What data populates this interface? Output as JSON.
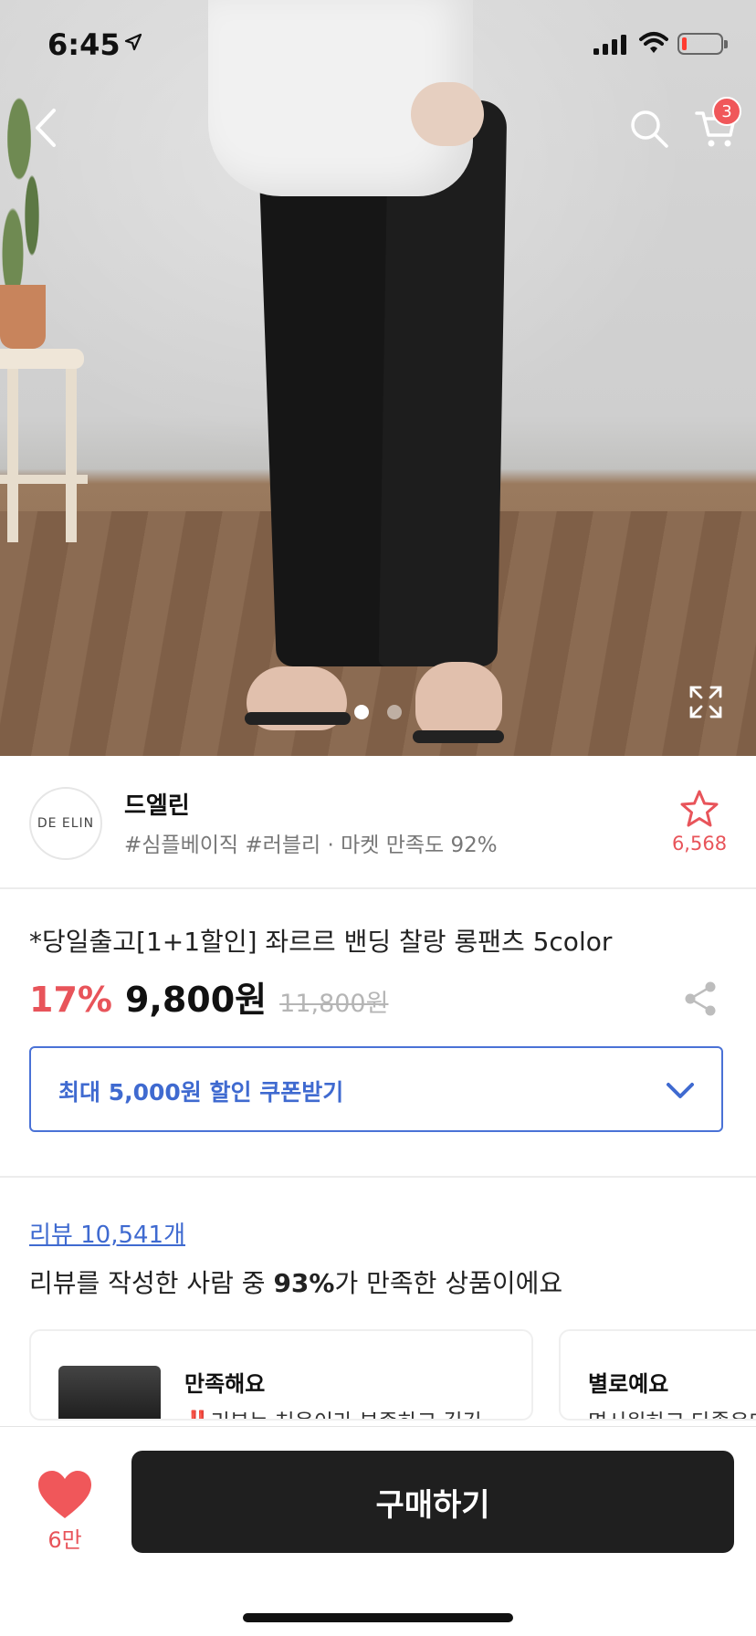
{
  "status_bar": {
    "time": "6:45"
  },
  "hero": {
    "slide_count": 2,
    "active_slide": 1
  },
  "header": {
    "cart_count": "3"
  },
  "store": {
    "logo_text": "DE ELIN",
    "name": "드엘린",
    "tags": "#심플베이직 #러블리 · 마켓 만족도 92%",
    "favorite_count": "6,568"
  },
  "product": {
    "title": "*당일출고[1+1할인] 좌르르 밴딩 찰랑 롱팬츠 5color",
    "discount": "17%",
    "price": "9,800원",
    "original_price": "11,800원"
  },
  "coupon": {
    "label": "최대 5,000원 할인 쿠폰받기"
  },
  "reviews": {
    "link_label": "리뷰 10,541개",
    "summary_prefix": "리뷰를 작성한 사람 중 ",
    "summary_percent": "93%",
    "summary_suffix": "가 만족한 상품이에요",
    "cards": [
      {
        "title": "만족해요",
        "excl": "‼️",
        "text": "리뷰는 처음이라 부족하고 길긴"
      },
      {
        "title": "별로예요",
        "text": "면시원하고 다좋은데"
      }
    ]
  },
  "bottom_bar": {
    "like_count": "6만",
    "buy_label": "구매하기"
  },
  "colors": {
    "accent_red": "#e8545a",
    "link_blue": "#3f6ad0",
    "buy_button": "#1f1f1f"
  }
}
